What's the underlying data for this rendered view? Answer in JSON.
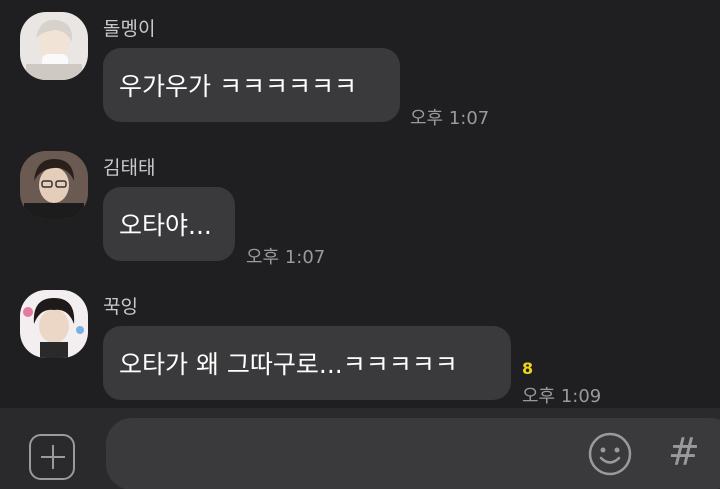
{
  "messages": [
    {
      "sender": "돌멩이",
      "text": "우가우가 ㅋㅋㅋㅋㅋㅋ",
      "time": "오후 1:07",
      "unread": ""
    },
    {
      "sender": "김태태",
      "text": "오타야...",
      "time": "오후 1:07",
      "unread": ""
    },
    {
      "sender": "꾹잉",
      "text": "오타가 왜 그따구로...ㅋㅋㅋㅋㅋ",
      "time": "오후 1:09",
      "unread": "8"
    }
  ],
  "composer": {
    "add_icon": "plus-square-icon",
    "emoji_icon": "smiley-icon",
    "hash_label": "#"
  },
  "colors": {
    "background": "#1f1f21",
    "bubble": "#3a3a3c",
    "unread": "#f2d21a"
  }
}
